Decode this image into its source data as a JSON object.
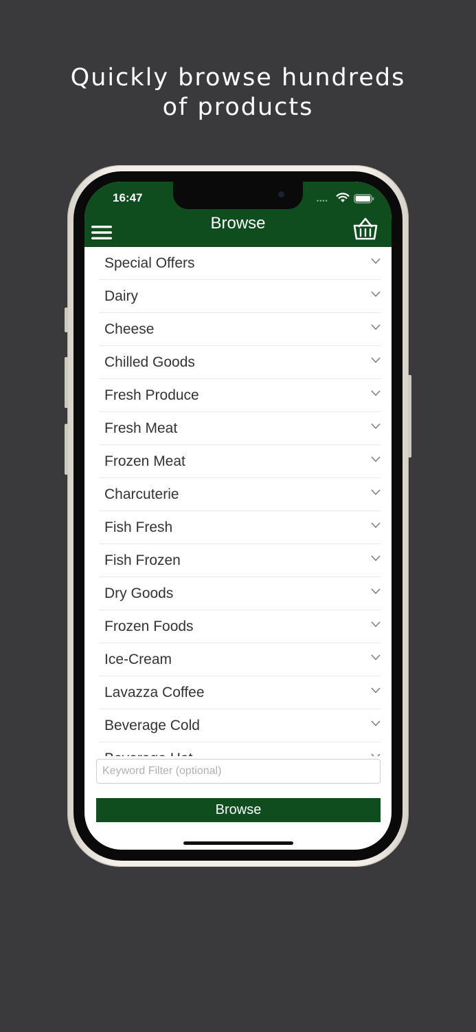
{
  "headline": {
    "line1": "Quickly browse hundreds",
    "line2": "of products"
  },
  "status_bar": {
    "time": "16:47"
  },
  "nav": {
    "title": "Browse",
    "menu_icon": "hamburger-menu-icon",
    "basket_icon": "shopping-basket-icon"
  },
  "categories": [
    "Special Offers",
    "Dairy",
    "Cheese",
    "Chilled Goods",
    "Fresh Produce",
    "Fresh Meat",
    "Frozen Meat",
    "Charcuterie",
    "Fish Fresh",
    "Fish Frozen",
    "Dry Goods",
    "Frozen Foods",
    "Ice-Cream",
    "Lavazza Coffee",
    "Beverage Cold",
    "Beverage Hot"
  ],
  "filter": {
    "placeholder": "Keyword Filter (optional)",
    "value": ""
  },
  "browse_button": {
    "label": "Browse"
  },
  "colors": {
    "brand_green": "#0f4d1f",
    "background": "#3a3a3c"
  }
}
